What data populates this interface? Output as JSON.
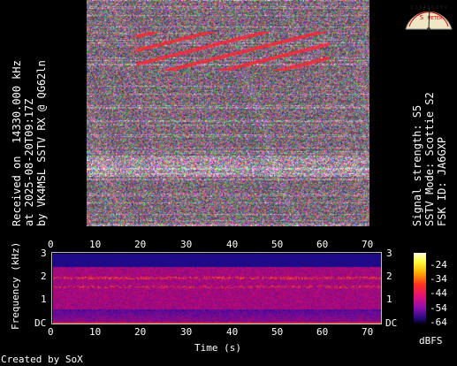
{
  "left_caption": {
    "line1": "Received on  14330.000 kHz",
    "line2": "at 2025-08-20T09:17Z",
    "line3": "by VK4MSL SSTV RX @ QG62ln"
  },
  "right_caption": {
    "line1": "Signal strength: S5",
    "line2": "SSTV Mode: Scottie S2",
    "line3": "FSK ID: JA6GXP"
  },
  "meter": {
    "scale": "1 2 3 4 5 6 7 8 9",
    "letter": "S",
    "unit": "METER",
    "reading": "S5"
  },
  "spectrogram": {
    "x_ticks": [
      "0",
      "10",
      "20",
      "30",
      "40",
      "50",
      "60",
      "70"
    ],
    "y_ticks": [
      "3",
      "2",
      "1",
      "DC"
    ],
    "xlabel": "Time (s)",
    "ylabel": "Frequency (kHz)"
  },
  "colorbar": {
    "ticks": [
      "-24",
      "-34",
      "-44",
      "-54",
      "-64"
    ],
    "label": "dBFS"
  },
  "footer": {
    "credit": "Created by SoX"
  },
  "colors": {
    "background": "#000000",
    "frame": "#bbbbbb"
  }
}
